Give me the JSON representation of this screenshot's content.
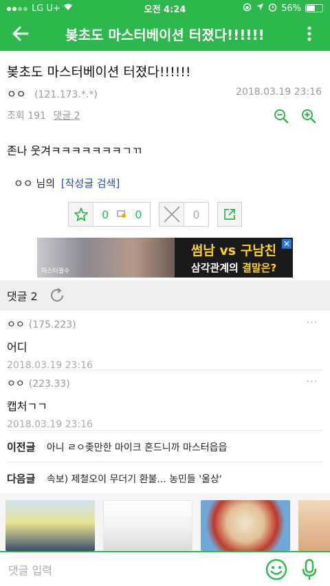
{
  "status_bar": {
    "carrier": "LG U+",
    "time": "오전 4:24",
    "battery": "56%",
    "battery_level": 0.56
  },
  "app_bar": {
    "title": "봊초도 마스터베이션 터졌다!!!!!!"
  },
  "article": {
    "title": "봊초도 마스터베이션 터졌다!!!!!!",
    "author": "ㅇㅇ",
    "ip": "(121.173.*.*)",
    "date": "2018.03.19 23:16",
    "views_label": "조회 191",
    "comments_label": "댓글 2",
    "body": "존나 웃겨ㅋㅋㅋㅋㅋㅋㅋㄱㄲ",
    "writer_suffix": "님의",
    "search_label": "[작성글 검색]",
    "recommend_count": "0",
    "fixed_count": "0",
    "dislike_count": "0"
  },
  "ad": {
    "image_caption": "마스터블수",
    "line1": "썸남 vs 구남친",
    "line2_a": "삼각관계의 ",
    "line2_b": "결말은?"
  },
  "comments_header": {
    "label": "댓글 2"
  },
  "comments": [
    {
      "name": "ㅇㅇ",
      "ip": "(175.223)",
      "text": "어디",
      "date": "2018.03.19 23:16"
    },
    {
      "name": "ㅇㅇ",
      "ip": "(223.33)",
      "text": "캡처ㄱㄱ",
      "date": "2018.03.19 23:16"
    }
  ],
  "prev": {
    "label": "이전글",
    "title": "아니 ㄹㅇ좆만한 마이크 혼드니까 마스터읍읍"
  },
  "next": {
    "label": "다음글",
    "title": "속보) 제철오이 무더기 환불... 농민들 '울상'"
  },
  "bottom_bar": {
    "placeholder": "댓글 입력"
  },
  "colors": {
    "brand": "#2db84b",
    "link": "#2a4ab8"
  }
}
